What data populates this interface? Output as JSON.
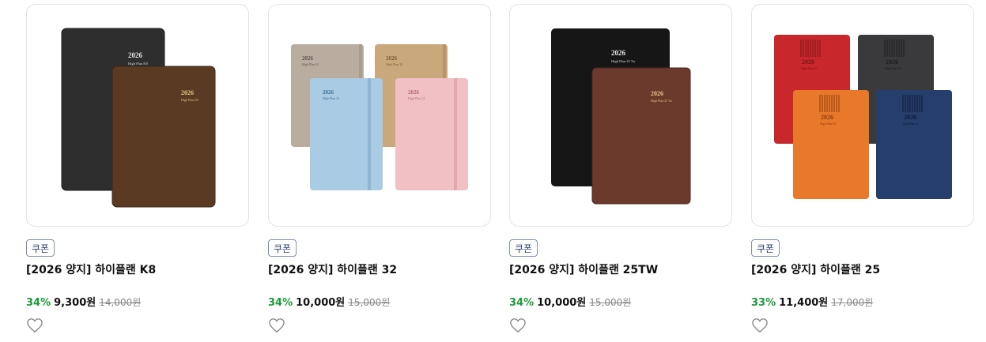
{
  "products": [
    {
      "badge": "쿠폰",
      "title": "[2026 양지] 하이플랜 K8",
      "discount": "34%",
      "price": "9,300원",
      "original_price": "14,000원",
      "image_text": {
        "year": "2026",
        "model": "High Plan K8"
      },
      "colors": [
        "#2e2e2e",
        "#5b3a24"
      ]
    },
    {
      "badge": "쿠폰",
      "title": "[2026 양지] 하이플랜 32",
      "discount": "34%",
      "price": "10,000원",
      "original_price": "15,000원",
      "image_text": {
        "year": "2026",
        "model": "High Plan 32"
      },
      "colors": [
        "#b9ada0",
        "#c9a97c",
        "#a9cbe3",
        "#f0c0c4"
      ]
    },
    {
      "badge": "쿠폰",
      "title": "[2026 양지] 하이플랜 25TW",
      "discount": "34%",
      "price": "10,000원",
      "original_price": "15,000원",
      "image_text": {
        "year": "2026",
        "model": "High Plan 25 Tw"
      },
      "colors": [
        "#161616",
        "#6b3a2c"
      ]
    },
    {
      "badge": "쿠폰",
      "title": "[2026 양지] 하이플랜 25",
      "discount": "33%",
      "price": "11,400원",
      "original_price": "17,000원",
      "image_text": {
        "year": "2026",
        "model": "High Plan 25"
      },
      "colors": [
        "#c8282b",
        "#3a3a3c",
        "#e8782a",
        "#263e6c"
      ]
    }
  ]
}
